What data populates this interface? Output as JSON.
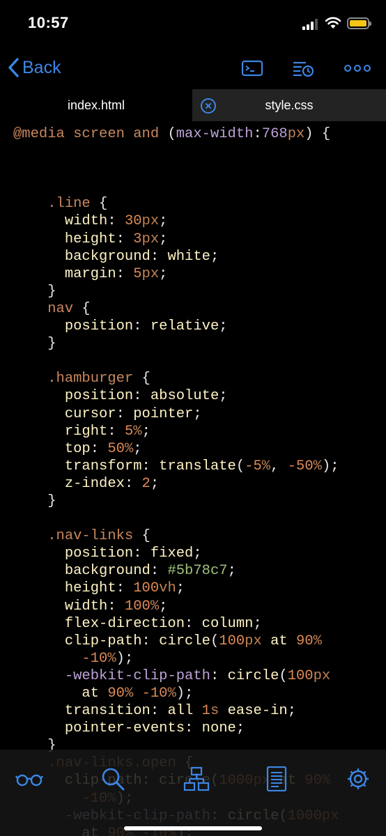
{
  "status": {
    "time": "10:57"
  },
  "navbar": {
    "back_label": "Back"
  },
  "tabs": [
    {
      "label": "index.html",
      "active": true
    },
    {
      "label": "style.css",
      "active": false
    }
  ],
  "code_lines": [
    "@media screen and (max-width:768px) {",
    "",
    "",
    "",
    "    .line {",
    "      width: 30px;",
    "      height: 3px;",
    "      background: white;",
    "      margin: 5px;",
    "    }",
    "    nav {",
    "      position: relative;",
    "    }",
    "",
    "    .hamburger {",
    "      position: absolute;",
    "      cursor: pointer;",
    "      right: 5%;",
    "      top: 50%;",
    "      transform: translate(-5%, -50%);",
    "      z-index: 2;",
    "    }",
    "",
    "    .nav-links {",
    "      position: fixed;",
    "      background: #5b78c7;",
    "      height: 100vh;",
    "      width: 100%;",
    "      flex-direction: column;",
    "      clip-path: circle(100px at 90%",
    "        -10%);",
    "      -webkit-clip-path: circle(100px",
    "        at 90% -10%);",
    "      transition: all 1s ease-in;",
    "      pointer-events: none;",
    "    }",
    "    .nav-links.open {",
    "      clip-path: circle(1000px at 90%",
    "        -10%);",
    "      -webkit-clip-path: circle(1000px",
    "        at 90% -10%);"
  ],
  "colors": {
    "accent": "#3c86e6",
    "tab_inactive_bg": "#232323",
    "battery": "#f5c518"
  },
  "toolbar_icons": [
    "glasses-icon",
    "search-icon",
    "hierarchy-icon",
    "document-icon",
    "gear-icon"
  ]
}
